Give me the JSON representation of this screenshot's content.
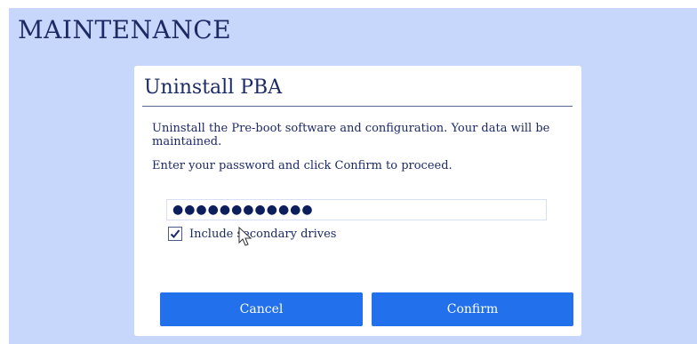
{
  "page": {
    "title": "MAINTENANCE"
  },
  "dialog": {
    "title": "Uninstall PBA",
    "description": "Uninstall the Pre-boot software and configuration. Your data will be maintained.",
    "instruction": "Enter your password and click Confirm to proceed.",
    "password": {
      "masked_value": "●●●●●●●●●●●●"
    },
    "checkbox": {
      "label": "Include secondary drives",
      "checked": true
    },
    "buttons": {
      "cancel": "Cancel",
      "confirm": "Confirm"
    }
  },
  "colors": {
    "background": "#c6d7fb",
    "panel": "#ffffff",
    "title_text": "#1c2a66",
    "button": "#2270ec",
    "button_text": "#ffffff"
  }
}
